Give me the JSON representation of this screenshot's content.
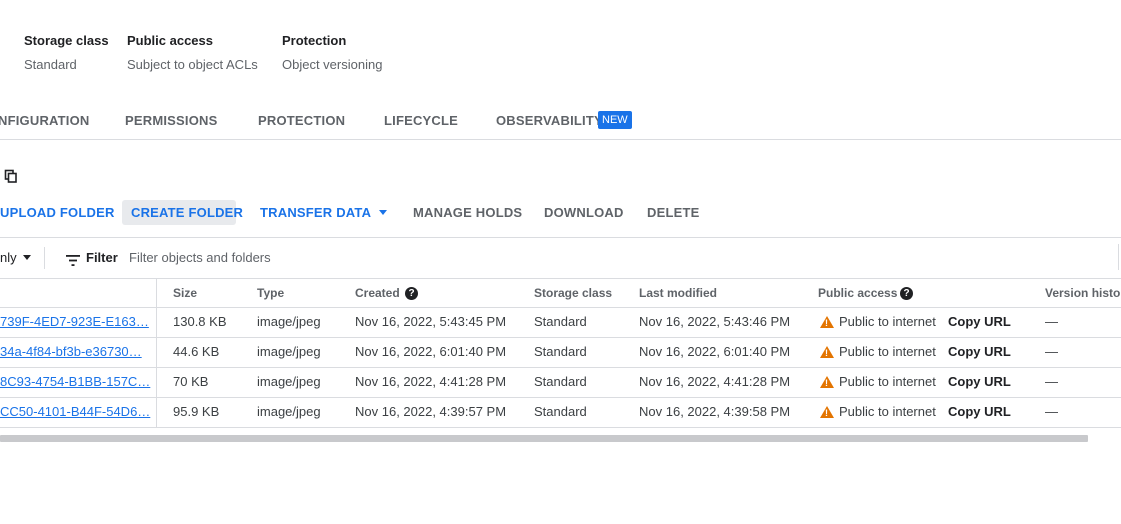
{
  "summary": [
    {
      "label": "Storage class",
      "value": "Standard"
    },
    {
      "label": "Public access",
      "value": "Subject to object ACLs"
    },
    {
      "label": "Protection",
      "value": "Object versioning"
    }
  ],
  "tabs": [
    {
      "label": "NFIGURATION"
    },
    {
      "label": "PERMISSIONS"
    },
    {
      "label": "PROTECTION"
    },
    {
      "label": "LIFECYCLE"
    },
    {
      "label": "OBSERVABILITY"
    }
  ],
  "new_badge": "NEW",
  "copy_icon": "copy-icon",
  "toolbar": {
    "upload_folder": "UPLOAD FOLDER",
    "create_folder": "CREATE FOLDER",
    "transfer_data": "TRANSFER DATA",
    "manage_holds": "MANAGE HOLDS",
    "download": "DOWNLOAD",
    "delete": "DELETE"
  },
  "filter": {
    "mode_label": "nly",
    "filter_label": "Filter",
    "placeholder": "Filter objects and folders"
  },
  "table": {
    "headers": {
      "size": "Size",
      "type": "Type",
      "created": "Created",
      "storage_class": "Storage class",
      "last_modified": "Last modified",
      "public_access": "Public access",
      "version_history": "Version history"
    },
    "rows": [
      {
        "name": "739F-4ED7-923E-E163…",
        "size": "130.8 KB",
        "type": "image/jpeg",
        "created": "Nov 16, 2022, 5:43:45 PM",
        "storage_class": "Standard",
        "last_modified": "Nov 16, 2022, 5:43:46 PM",
        "public_access": "Public to internet",
        "copy_url": "Copy URL",
        "version_history": "—"
      },
      {
        "name": "34a-4f84-bf3b-e36730…",
        "size": "44.6 KB",
        "type": "image/jpeg",
        "created": "Nov 16, 2022, 6:01:40 PM",
        "storage_class": "Standard",
        "last_modified": "Nov 16, 2022, 6:01:40 PM",
        "public_access": "Public to internet",
        "copy_url": "Copy URL",
        "version_history": "—"
      },
      {
        "name": "8C93-4754-B1BB-157C…",
        "size": "70 KB",
        "type": "image/jpeg",
        "created": "Nov 16, 2022, 4:41:28 PM",
        "storage_class": "Standard",
        "last_modified": "Nov 16, 2022, 4:41:28 PM",
        "public_access": "Public to internet",
        "copy_url": "Copy URL",
        "version_history": "—"
      },
      {
        "name": "CC50-4101-B44F-54D6…",
        "size": "95.9 KB",
        "type": "image/jpeg",
        "created": "Nov 16, 2022, 4:39:57 PM",
        "storage_class": "Standard",
        "last_modified": "Nov 16, 2022, 4:39:58 PM",
        "public_access": "Public to internet",
        "copy_url": "Copy URL",
        "version_history": "—"
      }
    ]
  },
  "colors": {
    "accent": "#1a73e8",
    "warning": "#e37400",
    "border": "#dadce0"
  }
}
